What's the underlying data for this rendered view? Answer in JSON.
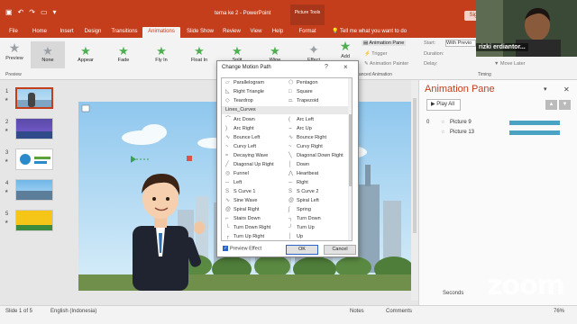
{
  "app": {
    "doc_title": "tema ke 2  -  PowerPoint",
    "context_tools": "Picture Tools",
    "sign_in": "Sig"
  },
  "tabs": [
    {
      "label": "File"
    },
    {
      "label": "Home"
    },
    {
      "label": "Insert"
    },
    {
      "label": "Design"
    },
    {
      "label": "Transitions"
    },
    {
      "label": "Animations"
    },
    {
      "label": "Slide Show"
    },
    {
      "label": "Review"
    },
    {
      "label": "View"
    },
    {
      "label": "Help"
    },
    {
      "label": "Format"
    }
  ],
  "tell_me": "Tell me what you want to do",
  "ribbon": {
    "preview": "Preview",
    "preview_group": "Preview",
    "gallery": [
      {
        "label": "None",
        "icon": "star-icon",
        "color": "grey"
      },
      {
        "label": "Appear",
        "icon": "star-icon",
        "color": "green"
      },
      {
        "label": "Fade",
        "icon": "star-icon",
        "color": "green"
      },
      {
        "label": "Fly In",
        "icon": "star-icon",
        "color": "green"
      },
      {
        "label": "Float In",
        "icon": "star-icon",
        "color": "green"
      },
      {
        "label": "Split",
        "icon": "star-icon",
        "color": "green"
      },
      {
        "label": "Wipe",
        "icon": "star-icon",
        "color": "green"
      }
    ],
    "effect": "Effect",
    "add": "Add",
    "animation_pane": "Animation Pane",
    "trigger": "Trigger",
    "animation_painter": "Animation Painter",
    "advanced_group": "anced Animation",
    "start_label": "Start:",
    "start_value": "With Previo",
    "duration_label": "Duration:",
    "delay_label": "Delay:",
    "move_later": "Move Later",
    "timing_group": "Timing"
  },
  "thumbs": [
    {
      "num": "1"
    },
    {
      "num": "2"
    },
    {
      "num": "3"
    },
    {
      "num": "4"
    },
    {
      "num": "5"
    }
  ],
  "dialog": {
    "title": "Change Motion Path",
    "help": "?",
    "close": "×",
    "top_items": [
      {
        "left": "Parallelogram",
        "right": "Pentagon"
      },
      {
        "left": "Right Triangle",
        "right": "Square"
      },
      {
        "left": "Teardrop",
        "right": "Trapezoid"
      }
    ],
    "section": "Lines_Curves",
    "items": [
      {
        "left": "Arc Down",
        "right": "Arc Left"
      },
      {
        "left": "Arc Right",
        "right": "Arc Up"
      },
      {
        "left": "Bounce Left",
        "right": "Bounce Right"
      },
      {
        "left": "Curvy Left",
        "right": "Curvy Right"
      },
      {
        "left": "Decaying Wave",
        "right": "Diagonal Down Right"
      },
      {
        "left": "Diagonal Up Right",
        "right": "Down"
      },
      {
        "left": "Funnel",
        "right": "Heartbeat"
      },
      {
        "left": "Left",
        "right": "Right"
      },
      {
        "left": "S Curve 1",
        "right": "S Curve 2"
      },
      {
        "left": "Sine Wave",
        "right": "Spiral Left"
      },
      {
        "left": "Spiral Right",
        "right": "Spring"
      },
      {
        "left": "Stairs Down",
        "right": "Turn Down"
      },
      {
        "left": "Turn Down Right",
        "right": "Turn Up"
      },
      {
        "left": "Turn Up Right",
        "right": "Up"
      }
    ],
    "preview_effect": "Preview Effect",
    "ok": "OK",
    "cancel": "Cancel"
  },
  "animation_pane": {
    "title": "Animation Pane",
    "play_all": "Play All",
    "items": [
      {
        "num": "0",
        "name": "Picture 9",
        "fill": 1.0
      },
      {
        "num": "",
        "name": "Picture 13",
        "fill": 1.0
      }
    ],
    "seconds": "Seconds"
  },
  "status": {
    "slide": "Slide 1 of 5",
    "language": "English (Indonesia)",
    "notes": "Notes",
    "comments": "Comments",
    "zoom": "76%"
  },
  "webcam": {
    "name": "rizki erdiantor..."
  },
  "watermark": "zoom"
}
